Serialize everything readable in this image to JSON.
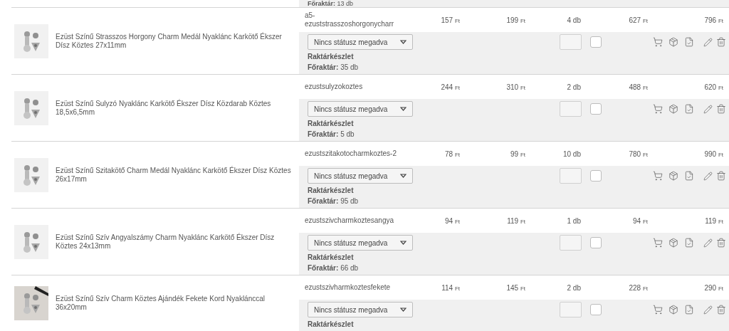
{
  "top_partial": {
    "warehouse_label": "Főraktár:",
    "warehouse_value": "13 db"
  },
  "rows": [
    {
      "name": "Ezüst Színű Strasszos Horgony Charm Medál Nyaklánc Karkötő Ékszer Dísz Köztes 27x11mm",
      "sku": "a5-ezuststrasszoshorgonycharr",
      "price_1": {
        "amount": "157",
        "unit": "Ft"
      },
      "price_2": {
        "amount": "199",
        "unit": "Ft"
      },
      "quantity": "4 db",
      "total_1": {
        "amount": "627",
        "unit": "Ft"
      },
      "total_2": {
        "amount": "796",
        "unit": "Ft"
      },
      "status": "Nincs státusz megadva",
      "checked": false,
      "stock_heading": "Raktárkészlet",
      "warehouse_label": "Főraktár:",
      "warehouse_value": "35 db"
    },
    {
      "name": "Ezüst Színű Sulyzó Nyaklánc Karkötő Ékszer Dísz Közdarab Köztes 18,5x6,5mm",
      "sku": "ezustsulyzokoztes",
      "price_1": {
        "amount": "244",
        "unit": "Ft"
      },
      "price_2": {
        "amount": "310",
        "unit": "Ft"
      },
      "quantity": "2 db",
      "total_1": {
        "amount": "488",
        "unit": "Ft"
      },
      "total_2": {
        "amount": "620",
        "unit": "Ft"
      },
      "status": "Nincs státusz megadva",
      "checked": false,
      "stock_heading": "Raktárkészlet",
      "warehouse_label": "Főraktár:",
      "warehouse_value": "5 db"
    },
    {
      "name": "Ezüst Színű Szitakötő Charm Medál Nyaklánc Karkötő Ékszer Dísz Köztes 26x17mm",
      "sku": "ezustszitakotocharmkoztes-2",
      "price_1": {
        "amount": "78",
        "unit": "Ft"
      },
      "price_2": {
        "amount": "99",
        "unit": "Ft"
      },
      "quantity": "10 db",
      "total_1": {
        "amount": "780",
        "unit": "Ft"
      },
      "total_2": {
        "amount": "990",
        "unit": "Ft"
      },
      "status": "Nincs státusz megadva",
      "checked": false,
      "stock_heading": "Raktárkészlet",
      "warehouse_label": "Főraktár:",
      "warehouse_value": "95 db"
    },
    {
      "name": "Ezüst Színű Szív Angyalszámy Charm Nyaklánc Karkötő Ékszer Dísz Köztes 24x13mm",
      "sku": "ezustszivcharmkoztesangya",
      "price_1": {
        "amount": "94",
        "unit": "Ft"
      },
      "price_2": {
        "amount": "119",
        "unit": "Ft"
      },
      "quantity": "1 db",
      "total_1": {
        "amount": "94",
        "unit": "Ft"
      },
      "total_2": {
        "amount": "119",
        "unit": "Ft"
      },
      "status": "Nincs státusz megadva",
      "checked": false,
      "stock_heading": "Raktárkészlet",
      "warehouse_label": "Főraktár:",
      "warehouse_value": "66 db"
    },
    {
      "name": "Ezüst Színű Szív Charm Köztes Ajándék Fekete Kord Nyaklánccal 36x20mm",
      "sku": "ezustszivharmkoztesfekete",
      "price_1": {
        "amount": "114",
        "unit": "Ft"
      },
      "price_2": {
        "amount": "145",
        "unit": "Ft"
      },
      "quantity": "2 db",
      "total_1": {
        "amount": "228",
        "unit": "Ft"
      },
      "total_2": {
        "amount": "290",
        "unit": "Ft"
      },
      "status": "Nincs státusz megadva",
      "checked": false,
      "stock_heading": "Raktárkészlet"
    }
  ]
}
